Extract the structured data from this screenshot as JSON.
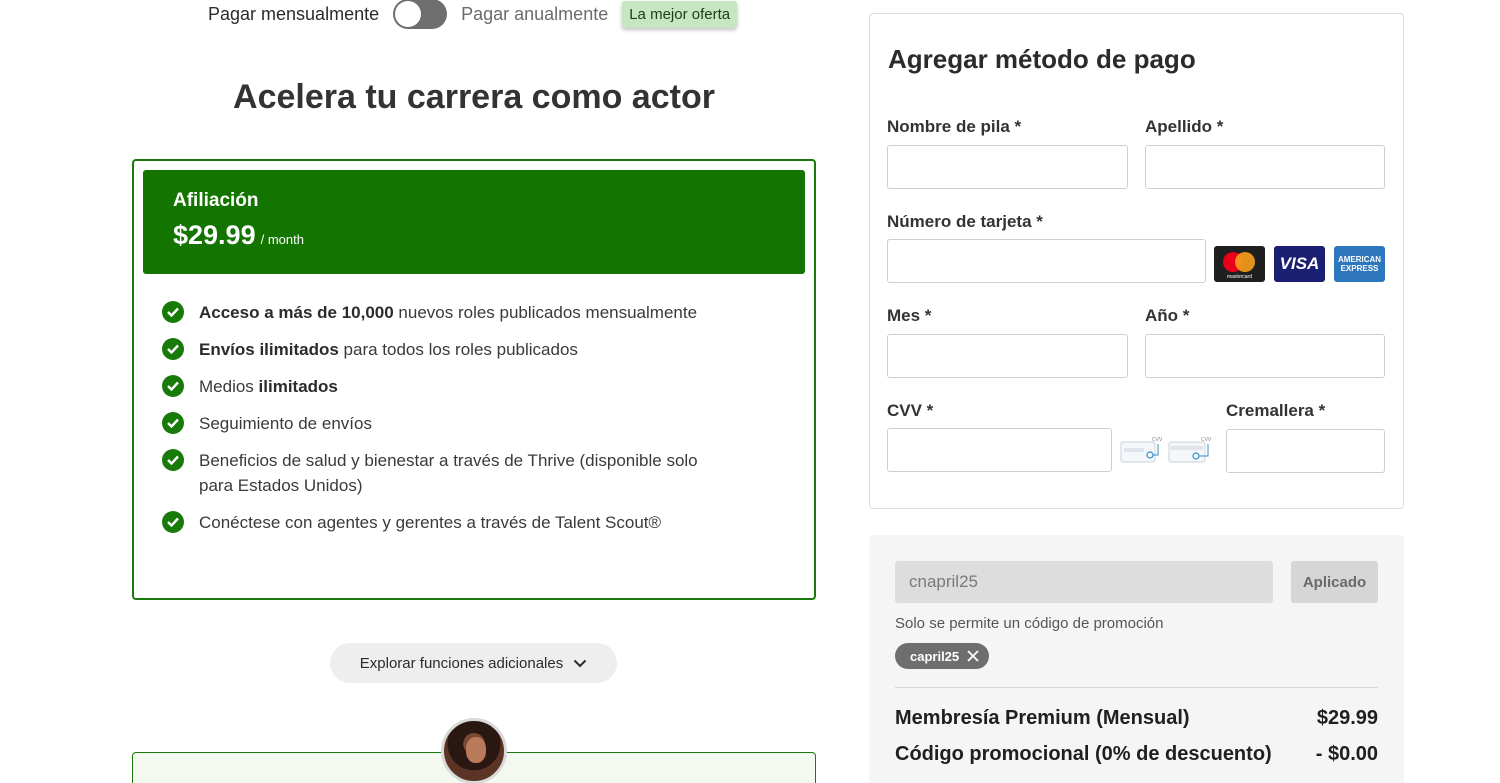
{
  "billing": {
    "monthly_label": "Pagar mensualmente",
    "annual_label": "Pagar anualmente",
    "best_offer_badge": "La mejor oferta",
    "toggle_state": "monthly"
  },
  "headline": "Acelera tu carrera como actor",
  "plan": {
    "name": "Afiliación",
    "price": "$29.99",
    "period": "/ month",
    "features": [
      {
        "bold_1": "Acceso a más de 10,000",
        "text_1": " nuevos roles publicados mensualmente",
        "bold_2": "",
        "text_2": ""
      },
      {
        "bold_1": "Envíos ilimitados",
        "text_1": " para todos los roles publicados",
        "bold_2": "",
        "text_2": ""
      },
      {
        "bold_1": "",
        "text_1": "Medios ",
        "bold_2": "ilimitados",
        "text_2": ""
      },
      {
        "bold_1": "",
        "text_1": "Seguimiento de envíos",
        "bold_2": "",
        "text_2": ""
      },
      {
        "bold_1": "",
        "text_1": "Beneficios de salud y bienestar a través de Thrive (disponible solo para Estados Unidos)",
        "bold_2": "",
        "text_2": ""
      },
      {
        "bold_1": "",
        "text_1": "Conéctese con agentes y gerentes a través de Talent Scout®",
        "bold_2": "",
        "text_2": ""
      }
    ],
    "explore_button": "Explorar funciones adicionales"
  },
  "payment": {
    "title": "Agregar método de pago",
    "first_name_label": "Nombre de pila *",
    "last_name_label": "Apellido *",
    "card_number_label": "Número de tarjeta *",
    "month_label": "Mes *",
    "year_label": "Año *",
    "cvv_label": "CVV *",
    "zip_label": "Cremallera *",
    "card_logos": {
      "mastercard": "mastercard",
      "visa": "VISA",
      "amex_line1": "AMERICAN",
      "amex_line2": "EXPRESS"
    },
    "cvv_hint": "CVV"
  },
  "promo": {
    "code_value": "cnapril25",
    "apply_button": "Aplicado",
    "note": "Solo se permite un código de promoción",
    "applied_chip": "capril25"
  },
  "summary": {
    "lines": [
      {
        "label": "Membresía Premium (Mensual)",
        "amount": "$29.99"
      },
      {
        "label": "Código promocional (0% de descuento)",
        "amount": "- $0.00"
      }
    ]
  },
  "colors": {
    "brand_green": "#137500",
    "badge_green": "#c6e6c1",
    "toggle_grey": "#6e6e6e"
  }
}
